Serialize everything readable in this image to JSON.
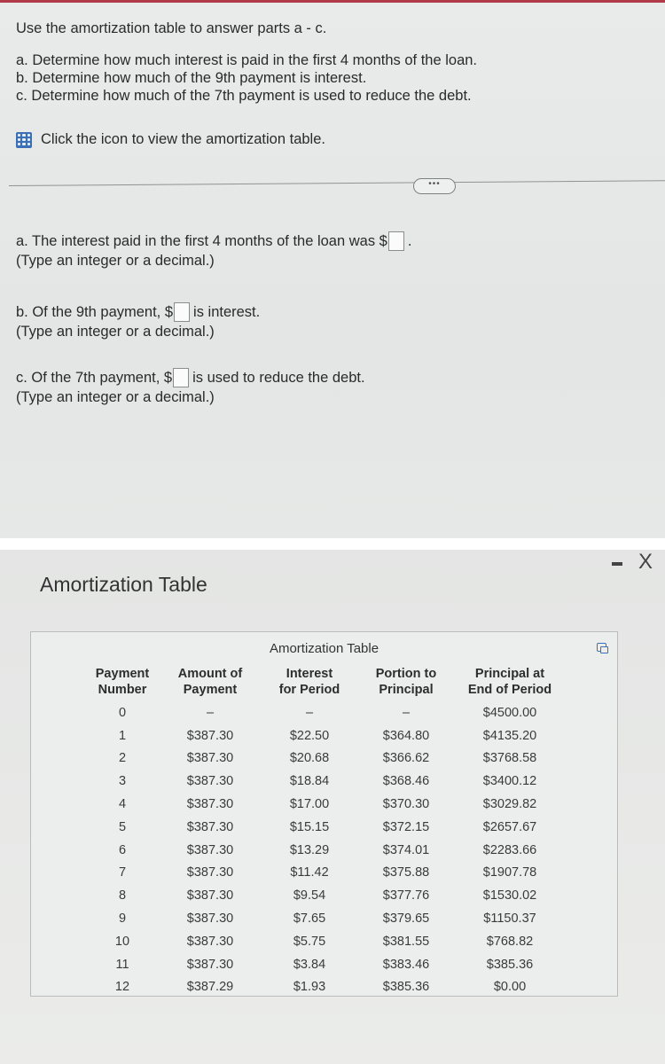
{
  "question": {
    "instruction": "Use the amortization table to answer parts a - c.",
    "parts": [
      "a. Determine how much interest is paid in the first 4 months of the loan.",
      "b. Determine how much of the 9th payment is interest.",
      "c. Determine how much of the 7th payment is used to reduce the debt."
    ],
    "icon_link_text": "Click the icon to view the amortization table.",
    "more_button": "•••"
  },
  "answers": {
    "a": {
      "prefix": "a. The interest paid in the first 4 months of the loan was $",
      "suffix": ".",
      "value": "",
      "hint": "(Type an integer or a decimal.)"
    },
    "b": {
      "prefix": "b. Of the 9th payment, $",
      "suffix": "is interest.",
      "value": "",
      "hint": "(Type an integer or a decimal.)"
    },
    "c": {
      "prefix": "c. Of the 7th payment, $",
      "suffix": "is used to reduce the debt.",
      "value": "",
      "hint": "(Type an integer or a decimal.)"
    }
  },
  "modal": {
    "title": "Amortization Table",
    "minimize": "—",
    "close": "X",
    "table": {
      "title": "Amortization Table",
      "headers": [
        [
          "Payment",
          "Number"
        ],
        [
          "Amount of",
          "Payment"
        ],
        [
          "Interest",
          "for Period"
        ],
        [
          "Portion to",
          "Principal"
        ],
        [
          "Principal at",
          "End of Period"
        ]
      ],
      "rows": [
        [
          "0",
          "–",
          "–",
          "–",
          "$4500.00"
        ],
        [
          "1",
          "$387.30",
          "$22.50",
          "$364.80",
          "$4135.20"
        ],
        [
          "2",
          "$387.30",
          "$20.68",
          "$366.62",
          "$3768.58"
        ],
        [
          "3",
          "$387.30",
          "$18.84",
          "$368.46",
          "$3400.12"
        ],
        [
          "4",
          "$387.30",
          "$17.00",
          "$370.30",
          "$3029.82"
        ],
        [
          "5",
          "$387.30",
          "$15.15",
          "$372.15",
          "$2657.67"
        ],
        [
          "6",
          "$387.30",
          "$13.29",
          "$374.01",
          "$2283.66"
        ],
        [
          "7",
          "$387.30",
          "$11.42",
          "$375.88",
          "$1907.78"
        ],
        [
          "8",
          "$387.30",
          "$9.54",
          "$377.76",
          "$1530.02"
        ],
        [
          "9",
          "$387.30",
          "$7.65",
          "$379.65",
          "$1150.37"
        ],
        [
          "10",
          "$387.30",
          "$5.75",
          "$381.55",
          "$768.82"
        ],
        [
          "11",
          "$387.30",
          "$3.84",
          "$383.46",
          "$385.36"
        ],
        [
          "12",
          "$387.29",
          "$1.93",
          "$385.36",
          "$0.00"
        ]
      ]
    }
  }
}
